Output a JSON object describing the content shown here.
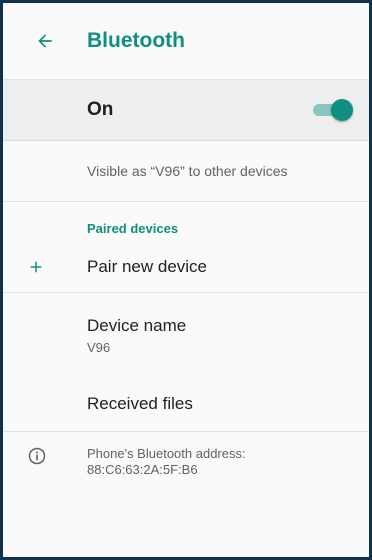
{
  "appbar": {
    "title": "Bluetooth",
    "back_icon": "arrow-back-icon"
  },
  "master": {
    "label": "On",
    "toggle_state": "on"
  },
  "visibility": {
    "text": "Visible as “V96” to other devices"
  },
  "paired": {
    "header": "Paired devices"
  },
  "pair_new": {
    "label": "Pair new device",
    "icon": "plus-icon"
  },
  "device_name": {
    "title": "Device name",
    "value": "V96"
  },
  "received_files": {
    "label": "Received files"
  },
  "address": {
    "line1": "Phone's Bluetooth address:",
    "line2": "88:C6:63:2A:5F:B6",
    "icon": "info-icon"
  },
  "colors": {
    "accent": "#0f8f80",
    "toggle_track": "#86c6bd",
    "master_bg": "#eeeeee"
  }
}
